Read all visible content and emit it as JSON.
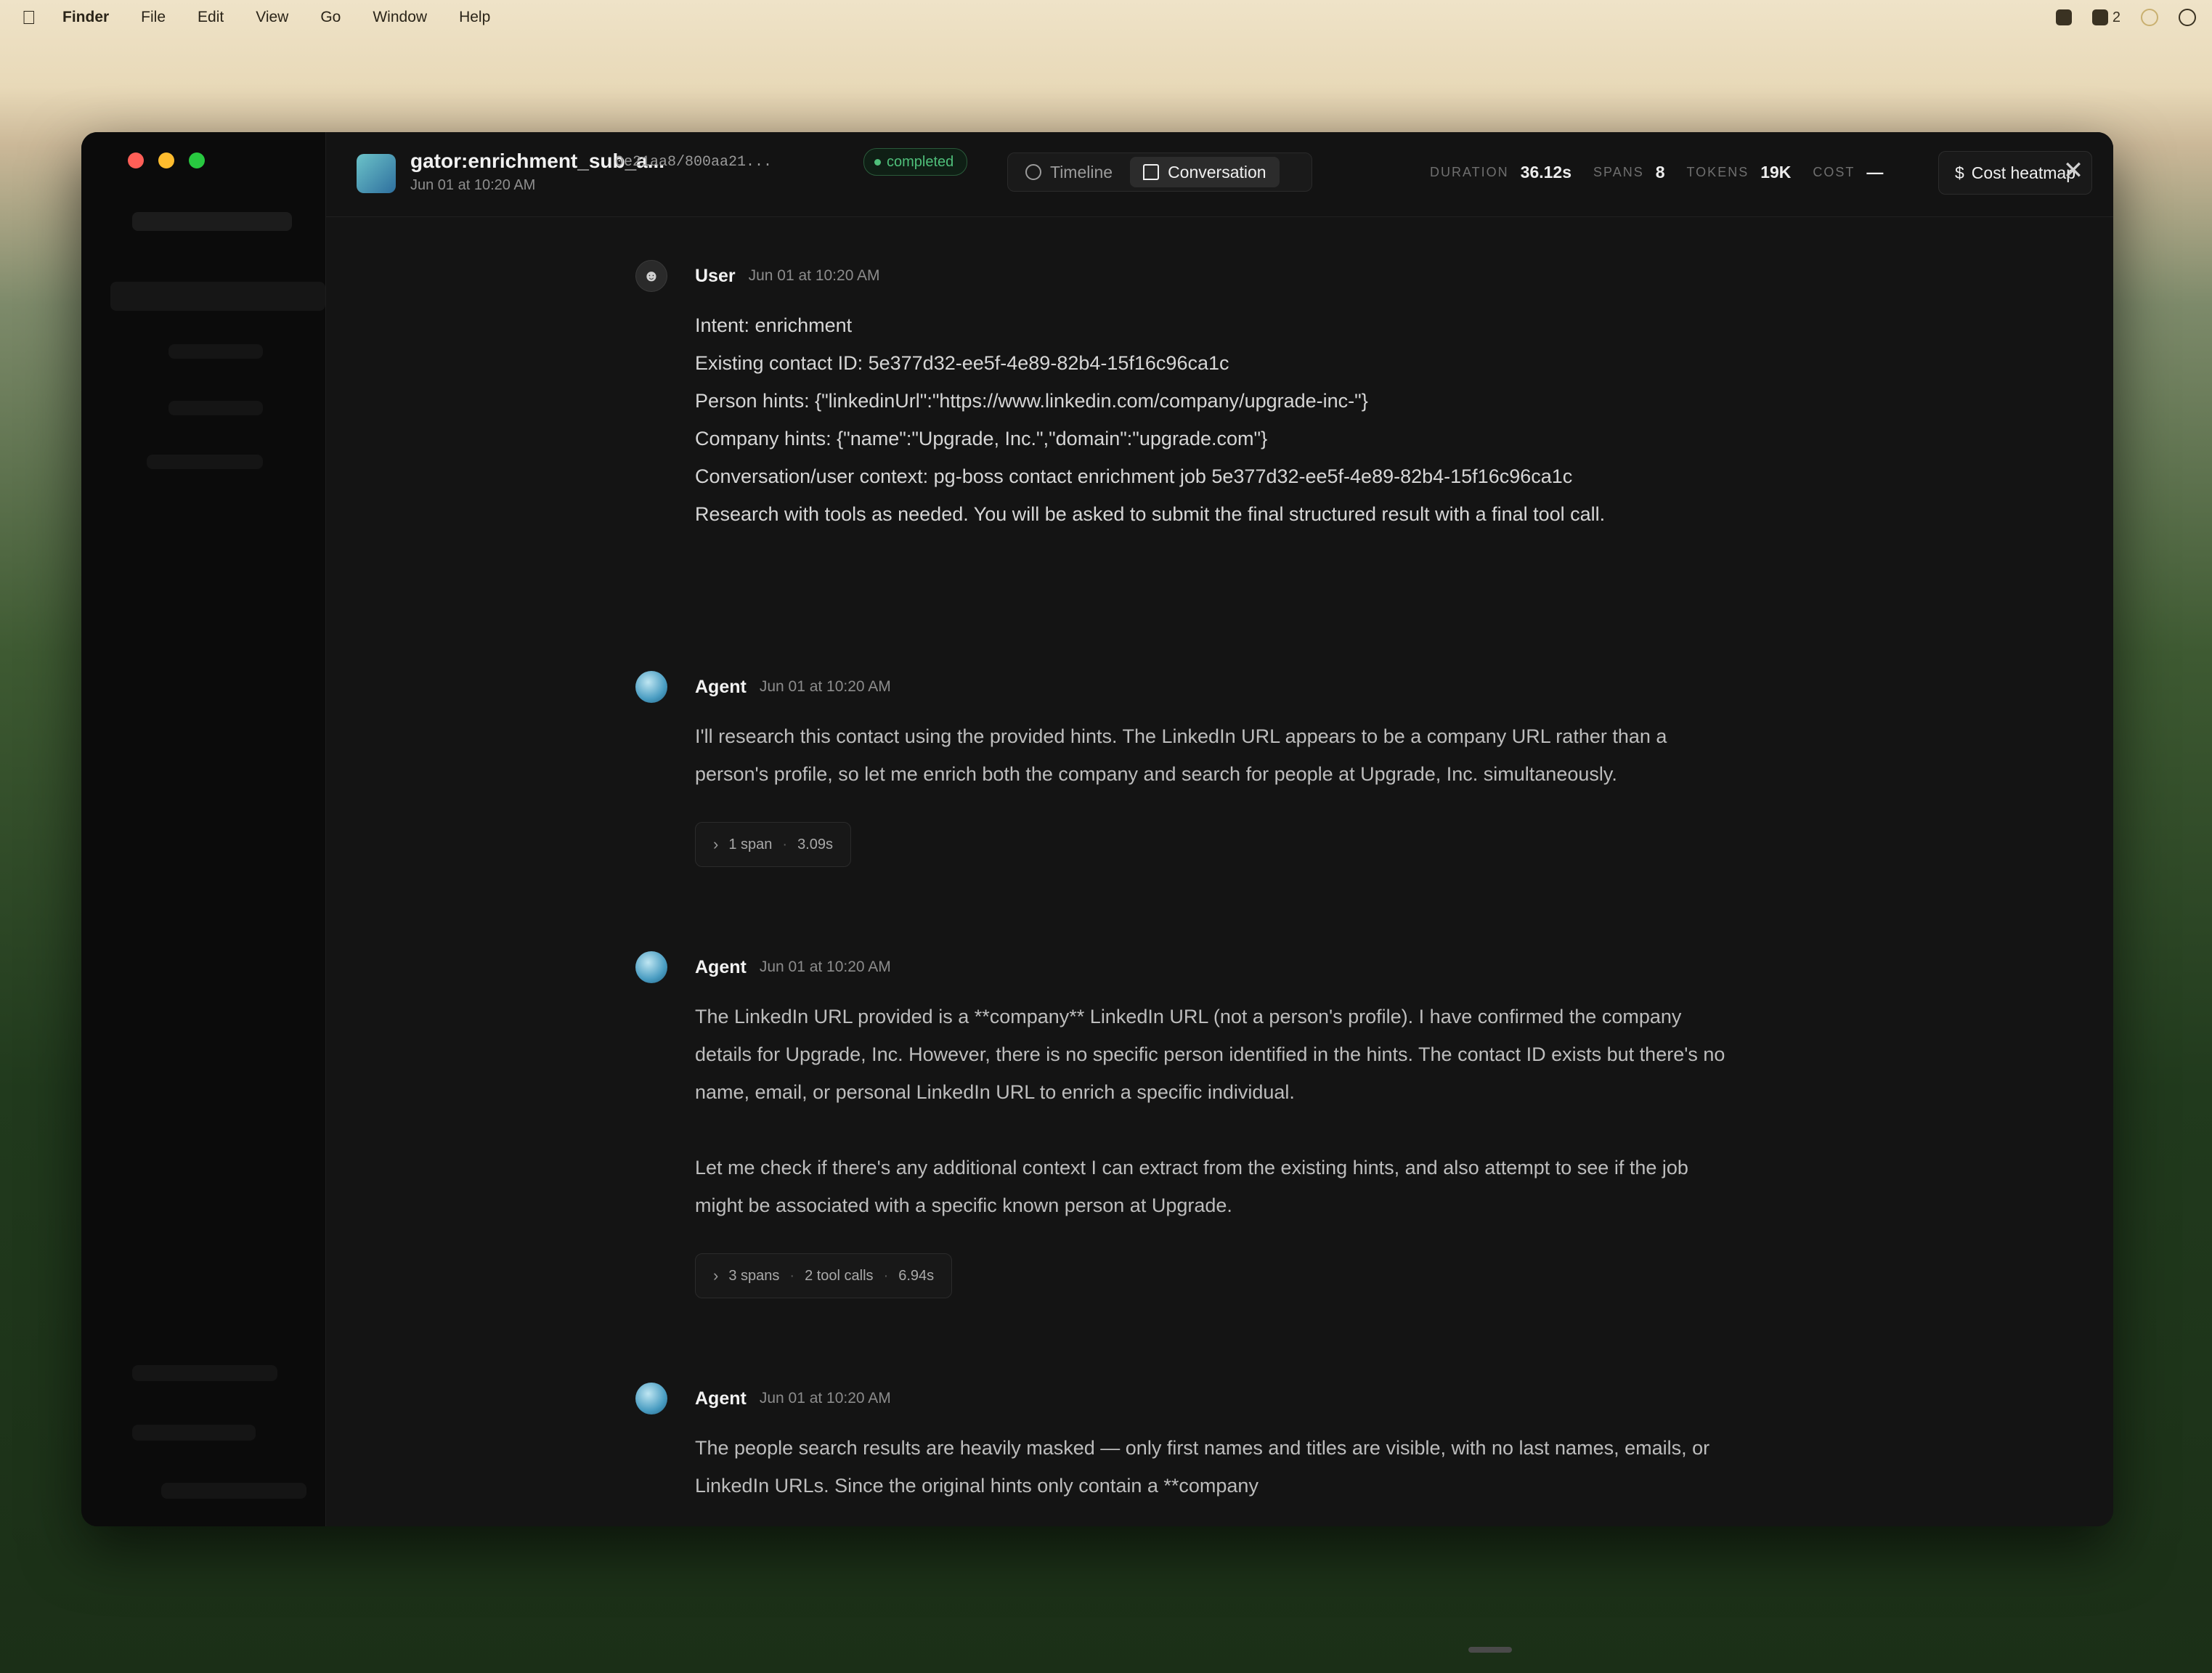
{
  "menubar": {
    "app": "Finder",
    "items": [
      "File",
      "Edit",
      "View",
      "Go",
      "Window",
      "Help"
    ],
    "tray_count": "2"
  },
  "session": {
    "title": "gator:enrichment_sub_a...",
    "id": "0e21aa8/800aa21...",
    "date": "Jun 01 at 10:20 AM",
    "status": "completed",
    "status_color": "#4fbf7a"
  },
  "tabs": [
    {
      "label": "Timeline",
      "active": false
    },
    {
      "label": "Conversation",
      "active": true
    }
  ],
  "stats": [
    {
      "label": "DURATION",
      "value": "36.12s"
    },
    {
      "label": "SPANS",
      "value": "8"
    },
    {
      "label": "TOKENS",
      "value": "19K"
    },
    {
      "label": "COST",
      "value": "—"
    }
  ],
  "cost_button": "Cost heatmap",
  "messages": [
    {
      "role": "user",
      "author": "User",
      "time": "Jun 01 at 10:20 AM",
      "lines": [
        "Intent: enrichment",
        "Existing contact ID: 5e377d32-ee5f-4e89-82b4-15f16c96ca1c",
        "Person hints: {\"linkedinUrl\":\"https://www.linkedin.com/company/upgrade-inc-\"}",
        "Company hints: {\"name\":\"Upgrade, Inc.\",\"domain\":\"upgrade.com\"}",
        "Conversation/user context: pg-boss contact enrichment job 5e377d32-ee5f-4e89-82b4-15f16c96ca1c",
        "Research with tools as needed. You will be asked to submit the final structured result with a final tool call."
      ]
    },
    {
      "role": "agent",
      "author": "Agent",
      "time": "Jun 01 at 10:20 AM",
      "paragraphs": [
        "I'll research this contact using the provided hints. The LinkedIn URL appears to be a company URL rather than a person's profile, so let me enrich both the company and search for people at Upgrade, Inc. simultaneously."
      ],
      "pill": {
        "spans": "1 span",
        "tools": "",
        "duration": "3.09s"
      }
    },
    {
      "role": "agent",
      "author": "Agent",
      "time": "Jun 01 at 10:20 AM",
      "paragraphs": [
        "The LinkedIn URL provided is a **company** LinkedIn URL (not a person's profile). I have confirmed the company details for Upgrade, Inc. However, there is no specific person identified in the hints. The contact ID exists but there's no name, email, or personal LinkedIn URL to enrich a specific individual.",
        "Let me check if there's any additional context I can extract from the existing hints, and also attempt to see if the job might be associated with a specific known person at Upgrade."
      ],
      "pill": {
        "spans": "3 spans",
        "tools": "2 tool calls",
        "duration": "6.94s"
      }
    },
    {
      "role": "agent",
      "author": "Agent",
      "time": "Jun 01 at 10:20 AM",
      "paragraphs": [
        "The people search results are heavily masked — only first names and titles are visible, with no last names, emails, or LinkedIn URLs. Since the original hints only contain a **company"
      ]
    }
  ]
}
